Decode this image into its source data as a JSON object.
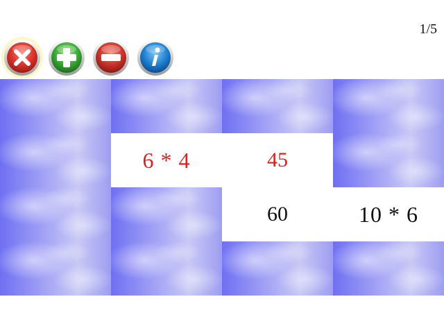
{
  "toolbar": {
    "buttons": [
      {
        "name": "close-button",
        "icon": "close-icon",
        "color": "#d8322a"
      },
      {
        "name": "add-button",
        "icon": "plus-icon",
        "color": "#3aa835"
      },
      {
        "name": "remove-button",
        "icon": "minus-icon",
        "color": "#c8322a"
      },
      {
        "name": "info-button",
        "icon": "info-icon",
        "color": "#1e7fd0"
      }
    ],
    "counter": "1/5"
  },
  "board": {
    "rows": 4,
    "cols": 4,
    "colors": {
      "matched": "#dd2020",
      "open": "#111111",
      "card_back": "#8c8cf4"
    },
    "cards": [
      {
        "state": "face-down",
        "text": ""
      },
      {
        "state": "face-down",
        "text": ""
      },
      {
        "state": "face-down",
        "text": ""
      },
      {
        "state": "face-down",
        "text": ""
      },
      {
        "state": "face-down",
        "text": ""
      },
      {
        "state": "matched",
        "text": "6 * 4"
      },
      {
        "state": "matched",
        "text": "45"
      },
      {
        "state": "face-down",
        "text": ""
      },
      {
        "state": "face-down",
        "text": ""
      },
      {
        "state": "face-down",
        "text": ""
      },
      {
        "state": "open",
        "text": "60"
      },
      {
        "state": "open",
        "text": "10 * 6"
      },
      {
        "state": "face-down",
        "text": ""
      },
      {
        "state": "face-down",
        "text": ""
      },
      {
        "state": "face-down",
        "text": ""
      },
      {
        "state": "face-down",
        "text": ""
      }
    ]
  }
}
